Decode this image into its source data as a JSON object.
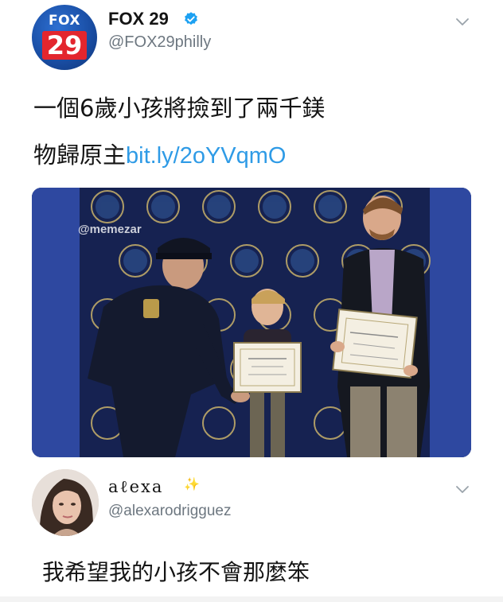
{
  "tweet": {
    "avatar": {
      "logo_top": "FOX",
      "logo_number": "29"
    },
    "display_name": "FOX 29",
    "handle": "@FOX29philly",
    "text_line1": "一個6歲小孩將撿到了兩千鎂",
    "text_line2": "物歸原主",
    "link": "bit.ly/2oYVqmO",
    "photo": {
      "watermark": "@memezar",
      "icon": "press-photo"
    }
  },
  "reply": {
    "display_name": "aℓexa",
    "sparkle": "✨",
    "handle": "@alexarodrigguez",
    "text": "我希望我的小孩不會那麼笨"
  },
  "colors": {
    "link": "#2f9be6",
    "verified": "#1da1f2",
    "handle_gray": "#6d7780",
    "fox_blue": "#1a4fa6",
    "fox_red": "#e3262e"
  }
}
